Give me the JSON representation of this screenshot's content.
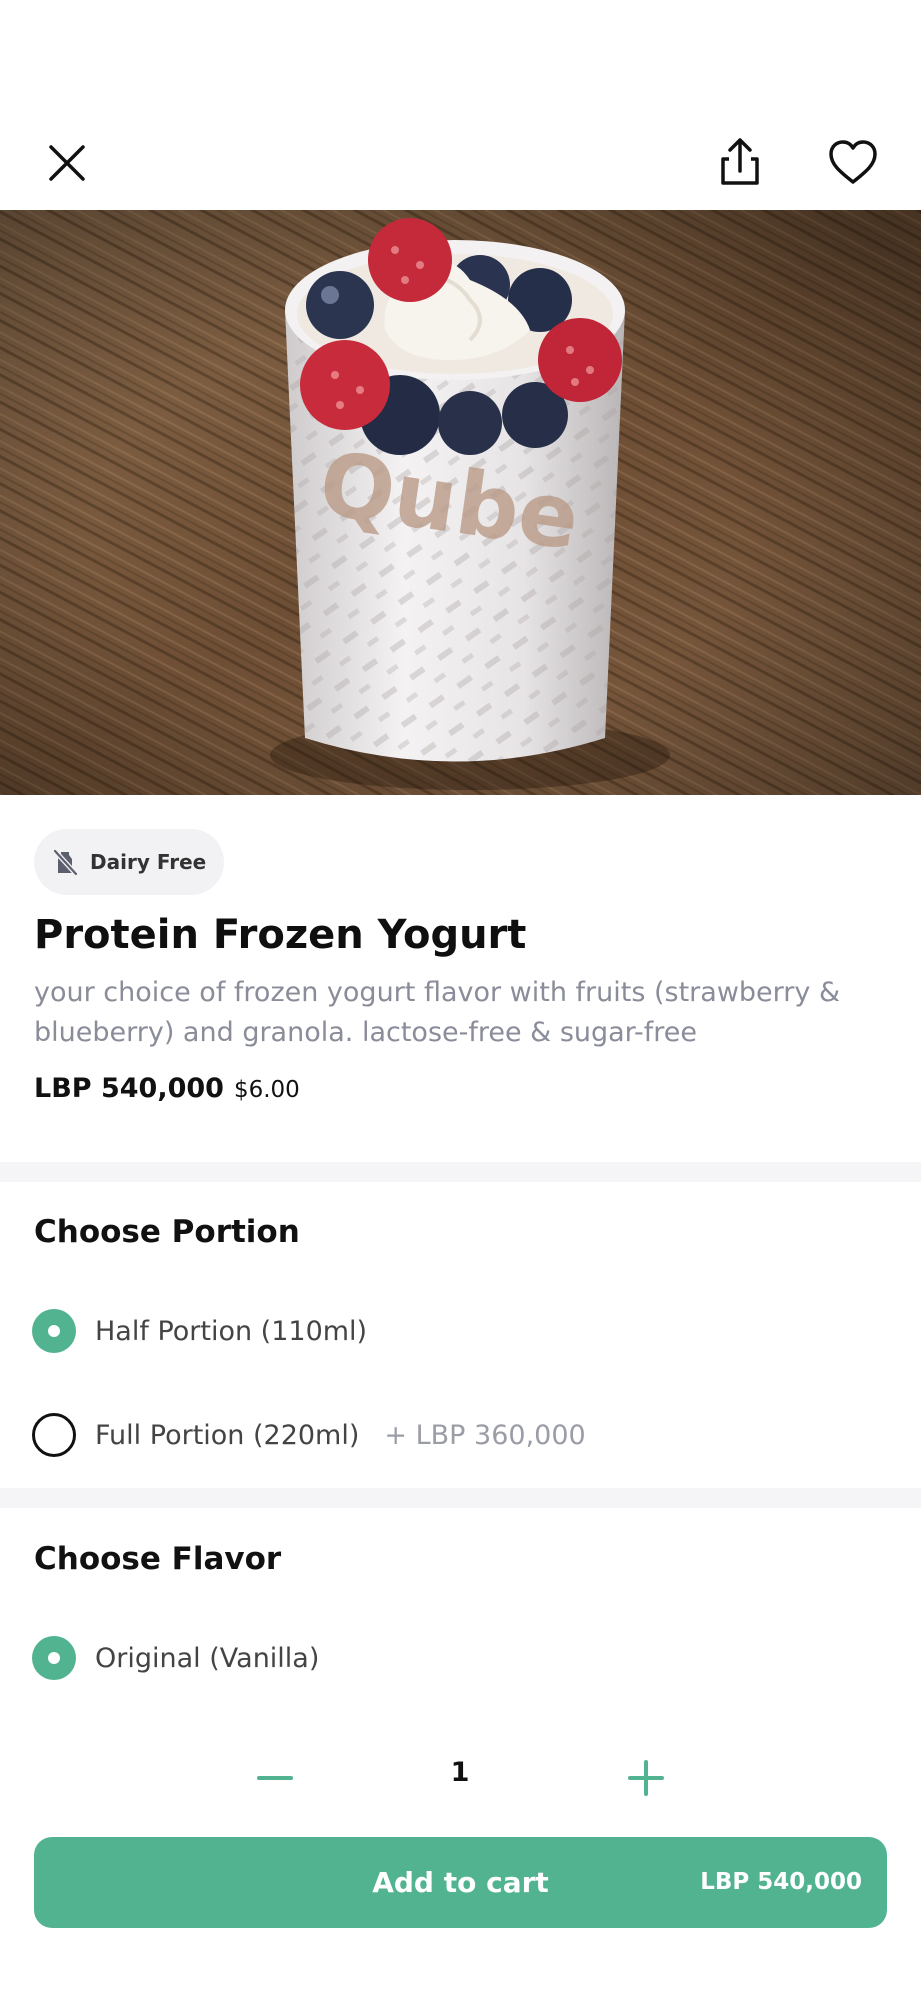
{
  "header": {
    "close_icon": "close-icon",
    "share_icon": "share-icon",
    "favorite_icon": "heart-icon"
  },
  "hero": {
    "image": "frozen-yogurt-cup-with-berries",
    "cup_logo_text": "Qube"
  },
  "product": {
    "tag_label": "Dairy Free",
    "tag_icon": "no-milk-icon",
    "title": "Protein Frozen Yogurt",
    "description": "your choice of frozen yogurt flavor with fruits (strawberry & blueberry) and granola. lactose-free & sugar-free",
    "price_lbp": "LBP 540,000",
    "price_usd": "$6.00"
  },
  "portion": {
    "title": "Choose Portion",
    "options": [
      {
        "label": "Half Portion (110ml)",
        "extra": "",
        "selected": true
      },
      {
        "label": "Full Portion (220ml)",
        "extra": "+ LBP 360,000",
        "selected": false
      }
    ]
  },
  "flavor": {
    "title": "Choose Flavor",
    "options": [
      {
        "label": "Original (Vanilla)",
        "selected": true
      }
    ]
  },
  "footer": {
    "quantity": "1",
    "minus_icon": "minus-icon",
    "plus_icon": "plus-icon",
    "add_to_cart_label": "Add to cart",
    "add_to_cart_price": "LBP 540,000"
  },
  "colors": {
    "accent": "#52b391",
    "muted_text": "#8a8d99",
    "divider": "#f5f5f7"
  }
}
